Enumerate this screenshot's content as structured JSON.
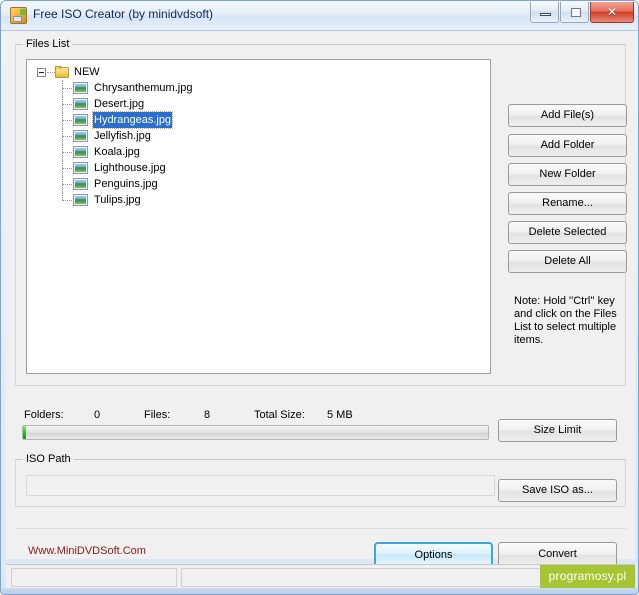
{
  "window": {
    "title": "Free ISO Creator (by minidvdsoft)",
    "icon": "app-iso-icon",
    "controls": {
      "minimize": "minimize-icon",
      "maximize": "maximize-icon",
      "close": "✕"
    }
  },
  "files_group": {
    "label": "Files List",
    "tree": {
      "root": {
        "label": "NEW",
        "expanded": true,
        "icon": "folder-icon"
      },
      "children": [
        {
          "label": "Chrysanthemum.jpg",
          "icon": "image-file-icon",
          "selected": false
        },
        {
          "label": "Desert.jpg",
          "icon": "image-file-icon",
          "selected": false
        },
        {
          "label": "Hydrangeas.jpg",
          "icon": "image-file-icon",
          "selected": true
        },
        {
          "label": "Jellyfish.jpg",
          "icon": "image-file-icon",
          "selected": false
        },
        {
          "label": "Koala.jpg",
          "icon": "image-file-icon",
          "selected": false
        },
        {
          "label": "Lighthouse.jpg",
          "icon": "image-file-icon",
          "selected": false
        },
        {
          "label": "Penguins.jpg",
          "icon": "image-file-icon",
          "selected": false
        },
        {
          "label": "Tulips.jpg",
          "icon": "image-file-icon",
          "selected": false
        }
      ]
    },
    "buttons": {
      "add_files": "Add File(s)",
      "add_folder": "Add Folder",
      "new_folder": "New Folder",
      "rename": "Rename...",
      "delete_selected": "Delete Selected",
      "delete_all": "Delete All"
    },
    "note": "Note: Hold ''Ctrl'' key and click on the Files List to select multiple items."
  },
  "stats": {
    "folders_label": "Folders:",
    "folders_value": "0",
    "files_label": "Files:",
    "files_value": "8",
    "total_size_label": "Total Size:",
    "total_size_value": "5 MB",
    "progress_percent": 0
  },
  "size_limit_button": "Size Limit",
  "iso_path": {
    "label": "ISO Path",
    "value": "",
    "placeholder": "",
    "save_button": "Save ISO as..."
  },
  "footer": {
    "website": "Www.MiniDVDSoft.Com",
    "options_button": "Options",
    "convert_button": "Convert"
  },
  "statusbar": {
    "panel1": "",
    "panel2": "",
    "badge": "programosy.pl"
  },
  "colors": {
    "selection_blue": "#2a6fd0",
    "focus_outline": "#d9a14b",
    "website_red": "#8b1a1a",
    "badge_green": "#a6c532",
    "progress_green": "#38b427",
    "focus_button_blue": "#3ba6e0",
    "title_text": "#0d2a53"
  }
}
